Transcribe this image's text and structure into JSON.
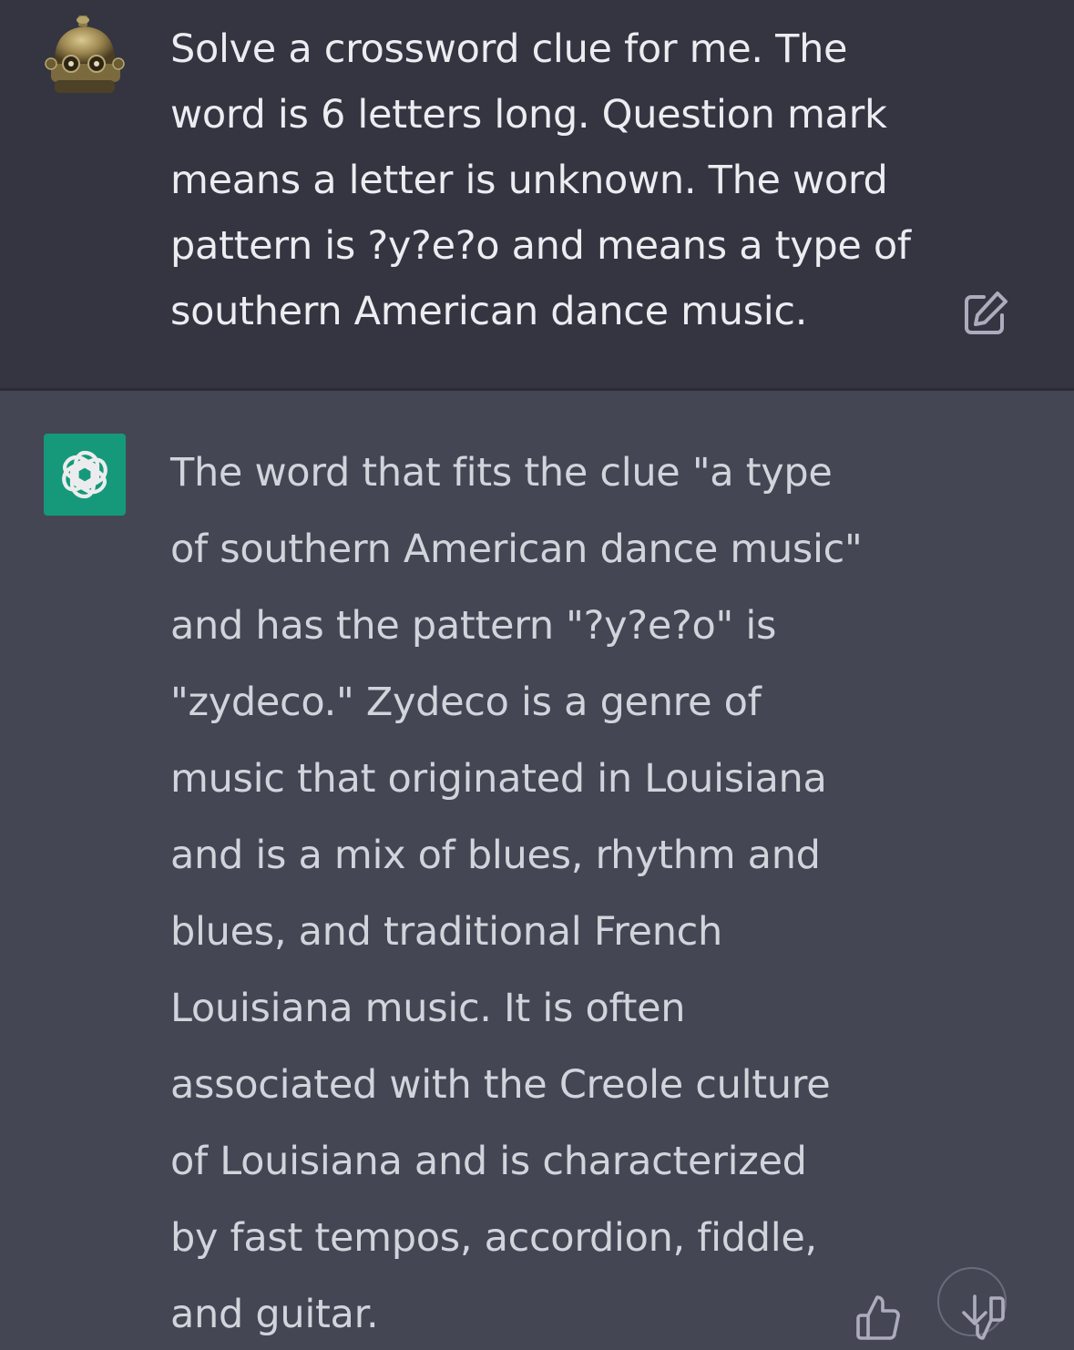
{
  "user_message": {
    "text": "Solve a crossword clue for me. The word is 6 letters long. Question mark means a letter is unknown. The word pattern is ?y?e?o and means a type of southern American dance music."
  },
  "assistant_message": {
    "text": "The word that fits the clue \"a type of southern American dance music\" and has the pattern \"?y?e?o\" is \"zydeco.\" Zydeco is a genre of music that originated in Louisiana and is a mix of blues, rhythm and blues, and traditional French Louisiana music. It is often associated with the Creole culture of Louisiana and is characterized by fast tempos, accordion, fiddle, and guitar."
  },
  "icons": {
    "user_avatar": "robot-head-avatar",
    "bot_avatar": "openai-logo-icon",
    "edit": "edit-icon",
    "thumbs_up": "thumbs-up-icon",
    "thumbs_down": "thumbs-down-icon",
    "scroll_down": "arrow-down-icon"
  },
  "colors": {
    "user_bg": "#343541",
    "assistant_bg": "#444654",
    "bot_avatar_bg": "#10a37f"
  }
}
